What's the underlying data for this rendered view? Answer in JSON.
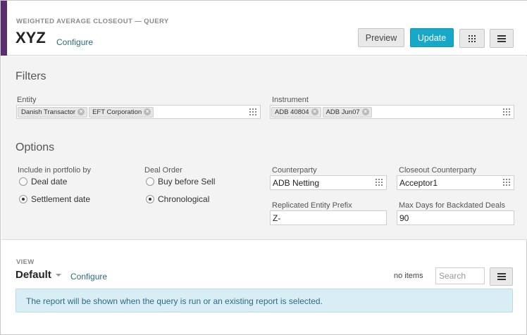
{
  "header": {
    "breadcrumb": "WEIGHTED AVERAGE CLOSEOUT — QUERY",
    "title": "XYZ",
    "configure_label": "Configure",
    "preview_label": "Preview",
    "update_label": "Update",
    "accent_color": "#5a2d6f",
    "primary_color": "#17a8c7"
  },
  "filters": {
    "title": "Filters",
    "entity": {
      "label": "Entity",
      "tags": [
        "Danish Transactor",
        "EFT Corporation"
      ]
    },
    "instrument": {
      "label": "Instrument",
      "tags": [
        "ADB 40804",
        "ADB Jun07"
      ]
    }
  },
  "options": {
    "title": "Options",
    "include_in_portfolio": {
      "label": "Include in portfolio by",
      "choices": [
        "Deal date",
        "Settlement date"
      ],
      "selected": "Settlement date"
    },
    "deal_order": {
      "label": "Deal Order",
      "choices": [
        "Buy before Sell",
        "Chronological"
      ],
      "selected": "Chronological"
    },
    "counterparty": {
      "label": "Counterparty",
      "value": "ADB Netting"
    },
    "closeout_counterparty": {
      "label": "Closeout Counterparty",
      "value": "Acceptor1"
    },
    "replicated_entity_prefix": {
      "label": "Replicated Entity Prefix",
      "value": "Z-"
    },
    "max_days_backdated": {
      "label": "Max Days for Backdated Deals",
      "value": "90"
    }
  },
  "view": {
    "label": "VIEW",
    "name": "Default",
    "configure_label": "Configure",
    "items_count": "no items",
    "search_placeholder": "Search",
    "info_message": "The report will be shown when the query is run or an existing report is selected."
  }
}
